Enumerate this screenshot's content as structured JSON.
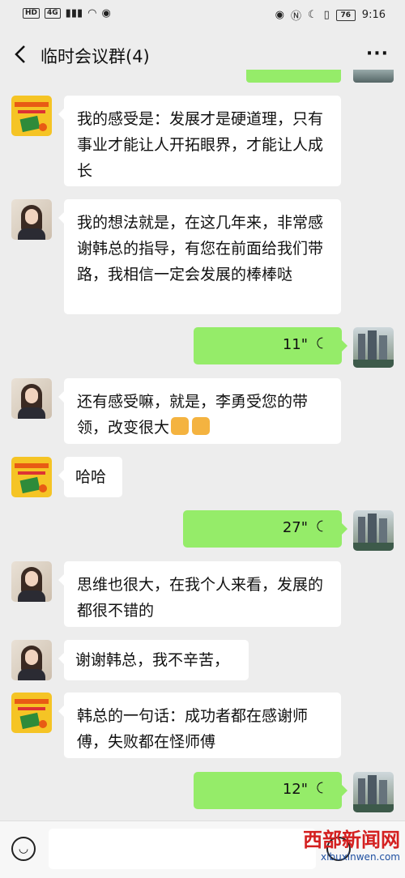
{
  "status": {
    "hd": "HD",
    "net": "4G",
    "battery": "76",
    "time": "9:16"
  },
  "header": {
    "title": "临时会议群(4)",
    "more": "···"
  },
  "messages": [
    {
      "text": "我的感受是：发展才是硬道理，只有事业才能让人开拓眼界，才能让人成长"
    },
    {
      "text": "我的想法就是，在这几年来，非常感谢韩总的指导，有您在前面给我们带路，我相信一定会发展的棒棒哒"
    },
    {
      "duration": "11\""
    },
    {
      "text": "还有感受嘛，就是，李勇受您的带领，改变很大"
    },
    {
      "text": "哈哈"
    },
    {
      "duration": "27\""
    },
    {
      "text": "思维也很大，在我个人来看，发展的都很不错的"
    },
    {
      "text": "谢谢韩总，我不辛苦，"
    },
    {
      "text": "韩总的一句话：成功者都在感谢师傅，失败都在怪师傅"
    },
    {
      "duration": "12\""
    }
  ],
  "watermark": {
    "cn": "西部新闻网",
    "url": "xibuxinwen.com"
  },
  "icons": {
    "thumbs_up": "thumbs-up-emoji",
    "voice_wave": "voice-wave-icon"
  }
}
